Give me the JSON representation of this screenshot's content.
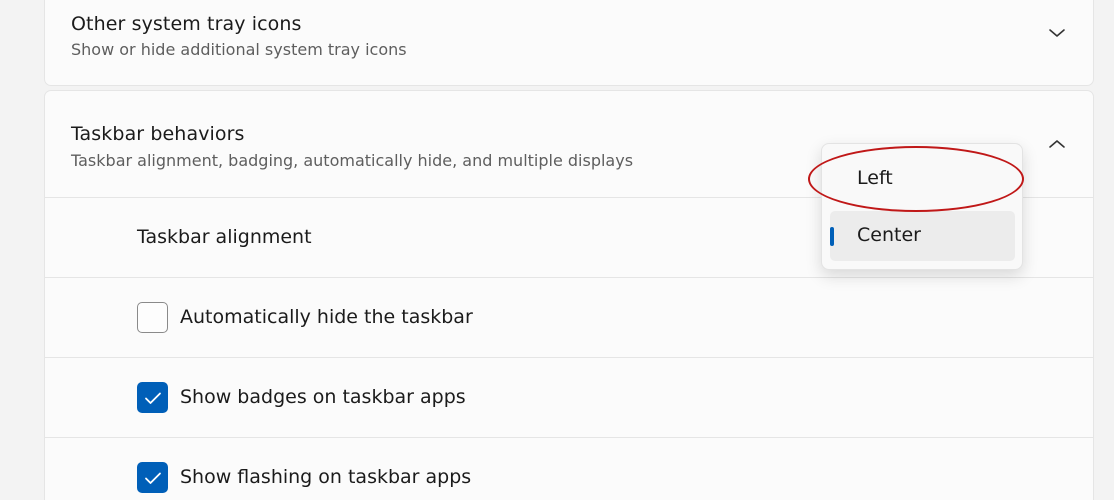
{
  "tray_section": {
    "title": "Other system tray icons",
    "subtitle": "Show or hide additional system tray icons",
    "expand_icon": "chevron-down-icon"
  },
  "behaviors_section": {
    "title": "Taskbar behaviors",
    "subtitle": "Taskbar alignment, badging, automatically hide, and multiple displays",
    "collapse_icon": "chevron-up-icon",
    "alignment": {
      "label": "Taskbar alignment",
      "options": [
        "Left",
        "Center"
      ],
      "selected": "Center"
    },
    "checkboxes": [
      {
        "label": "Automatically hide the taskbar",
        "checked": false
      },
      {
        "label": "Show badges on taskbar apps",
        "checked": true
      },
      {
        "label": "Show flashing on taskbar apps",
        "checked": true
      }
    ]
  },
  "colors": {
    "accent": "#005fb8",
    "annotation": "#c01818",
    "card_background": "#fbfbfb",
    "page_background": "#f3f3f3"
  }
}
